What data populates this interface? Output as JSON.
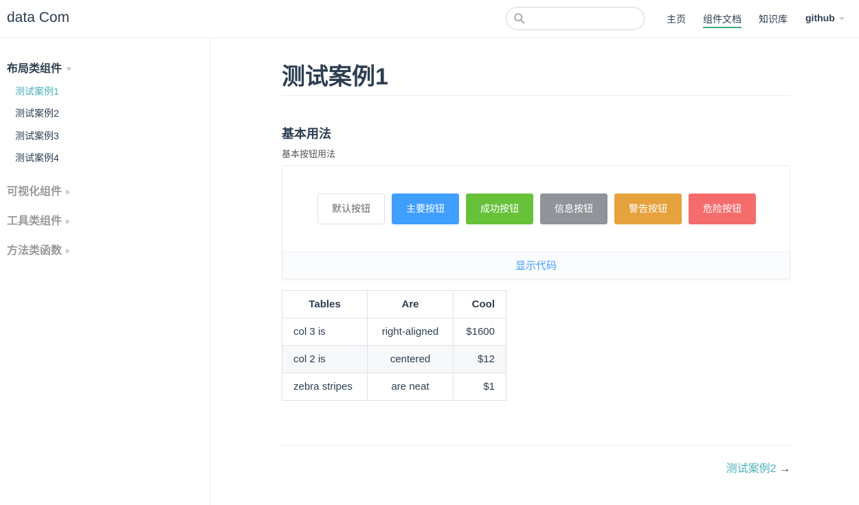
{
  "header": {
    "site_name": "data Com",
    "search_placeholder": "",
    "nav": [
      {
        "label": "主页"
      },
      {
        "label": "组件文档"
      },
      {
        "label": "知识库"
      },
      {
        "label": "github"
      }
    ]
  },
  "sidebar": {
    "groups": [
      {
        "title": "布局类组件",
        "items": [
          "测试案例1",
          "测试案例2",
          "测试案例3",
          "测试案例4"
        ]
      },
      {
        "title": "可视化组件"
      },
      {
        "title": "工具类组件"
      },
      {
        "title": "方法类函数"
      }
    ]
  },
  "content": {
    "title": "测试案例1",
    "section_title": "基本用法",
    "section_desc": "基本按钮用法",
    "buttons": [
      "默认按钮",
      "主要按钮",
      "成功按钮",
      "信息按钮",
      "警告按钮",
      "危险按钮"
    ],
    "code_toggle": "显示代码",
    "table": {
      "headers": [
        "Tables",
        "Are",
        "Cool"
      ],
      "rows": [
        [
          "col 3 is",
          "right-aligned",
          "$1600"
        ],
        [
          "col 2 is",
          "centered",
          "$12"
        ],
        [
          "zebra stripes",
          "are neat",
          "$1"
        ]
      ]
    },
    "next_link": "测试案例2",
    "next_arrow": "→"
  },
  "colors": {
    "accent": "#4ab0b9",
    "primary": "#409eff",
    "success": "#67c23a",
    "info": "#909399",
    "warning": "#e6a23c",
    "danger": "#f56c6c"
  }
}
